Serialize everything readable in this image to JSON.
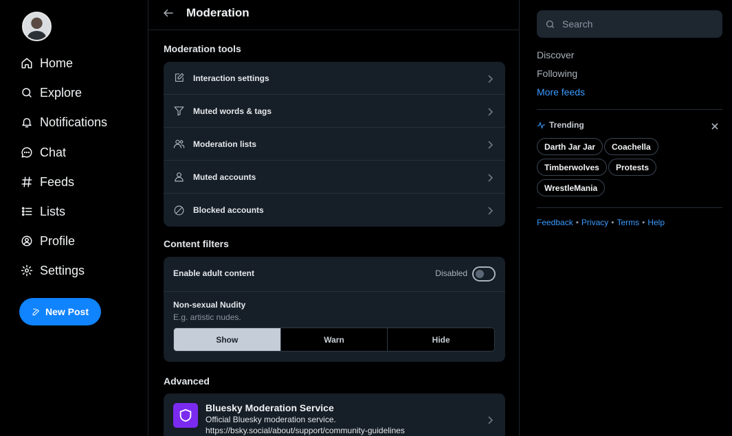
{
  "nav": {
    "items": [
      {
        "label": "Home",
        "icon": "home-icon"
      },
      {
        "label": "Explore",
        "icon": "search-icon"
      },
      {
        "label": "Notifications",
        "icon": "bell-icon"
      },
      {
        "label": "Chat",
        "icon": "chat-icon"
      },
      {
        "label": "Feeds",
        "icon": "hash-icon"
      },
      {
        "label": "Lists",
        "icon": "list-icon"
      },
      {
        "label": "Profile",
        "icon": "user-circle-icon"
      },
      {
        "label": "Settings",
        "icon": "gear-icon"
      }
    ],
    "new_post_label": "New Post"
  },
  "header": {
    "title": "Moderation"
  },
  "moderation_tools": {
    "heading": "Moderation tools",
    "items": [
      {
        "label": "Interaction settings",
        "icon": "edit-square-icon"
      },
      {
        "label": "Muted words & tags",
        "icon": "filter-icon"
      },
      {
        "label": "Moderation lists",
        "icon": "people-icon"
      },
      {
        "label": "Muted accounts",
        "icon": "person-icon"
      },
      {
        "label": "Blocked accounts",
        "icon": "block-icon"
      }
    ]
  },
  "content_filters": {
    "heading": "Content filters",
    "adult_label": "Enable adult content",
    "adult_status": "Disabled",
    "adult_enabled": false,
    "nudity": {
      "title": "Non-sexual Nudity",
      "description": "E.g. artistic nudes.",
      "options": [
        "Show",
        "Warn",
        "Hide"
      ],
      "selected": "Show"
    }
  },
  "advanced": {
    "heading": "Advanced",
    "service_name": "Bluesky Moderation Service",
    "service_desc": "Official Bluesky moderation service.",
    "service_url": "https://bsky.social/about/support/community-guidelines",
    "service_accent": "#7b2bf0"
  },
  "sidebar_right": {
    "search_placeholder": "Search",
    "feeds": [
      "Discover",
      "Following",
      "More feeds"
    ],
    "trending_title": "Trending",
    "trending": [
      "Darth Jar Jar",
      "Coachella",
      "Timberwolves",
      "Protests",
      "WrestleMania"
    ],
    "footer": [
      "Feedback",
      "Privacy",
      "Terms",
      "Help"
    ]
  },
  "colors": {
    "accent": "#1083fe",
    "link": "#3a9bff",
    "card": "#161e27"
  }
}
